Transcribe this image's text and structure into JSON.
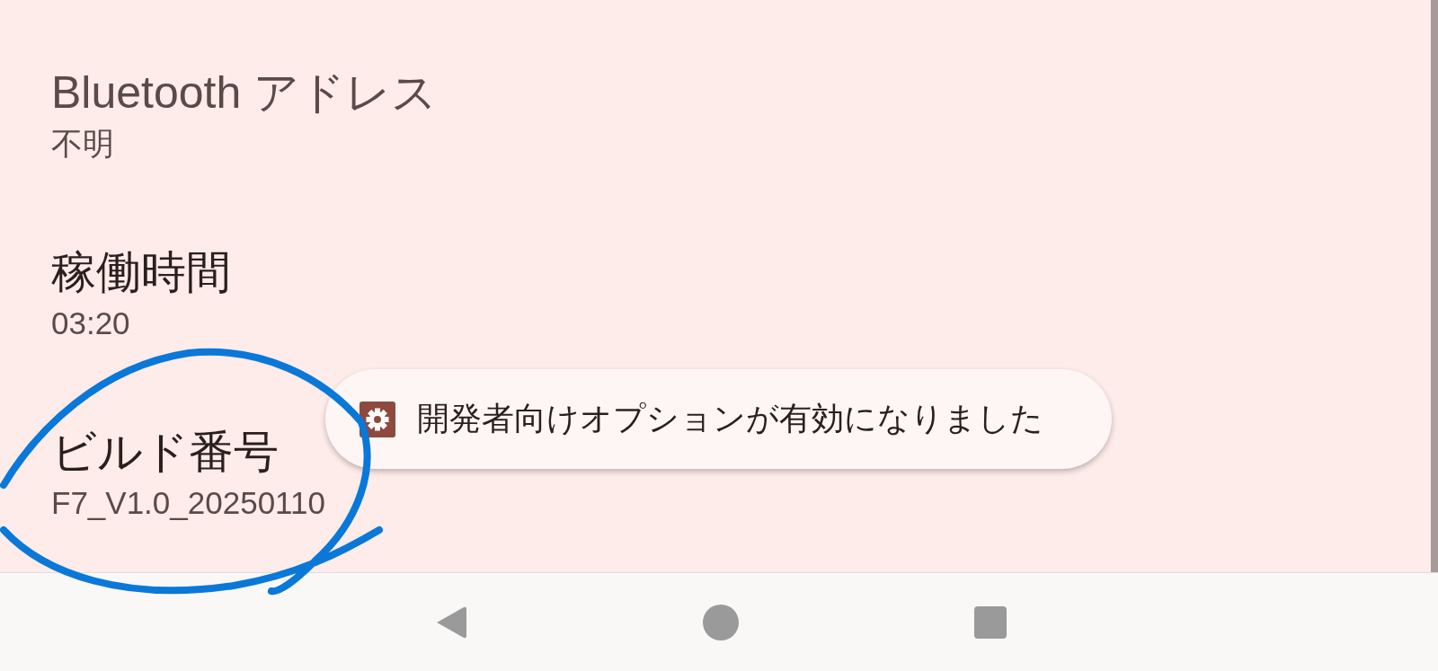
{
  "items": [
    {
      "title": "Bluetooth アドレス",
      "summary": "不明",
      "disabled": true
    },
    {
      "title": "稼働時間",
      "summary": "03:20",
      "disabled": false
    },
    {
      "title": "ビルド番号",
      "summary": "F7_V1.0_20250110",
      "disabled": false
    }
  ],
  "toast": {
    "message": "開発者向けオプションが有効になりました"
  }
}
